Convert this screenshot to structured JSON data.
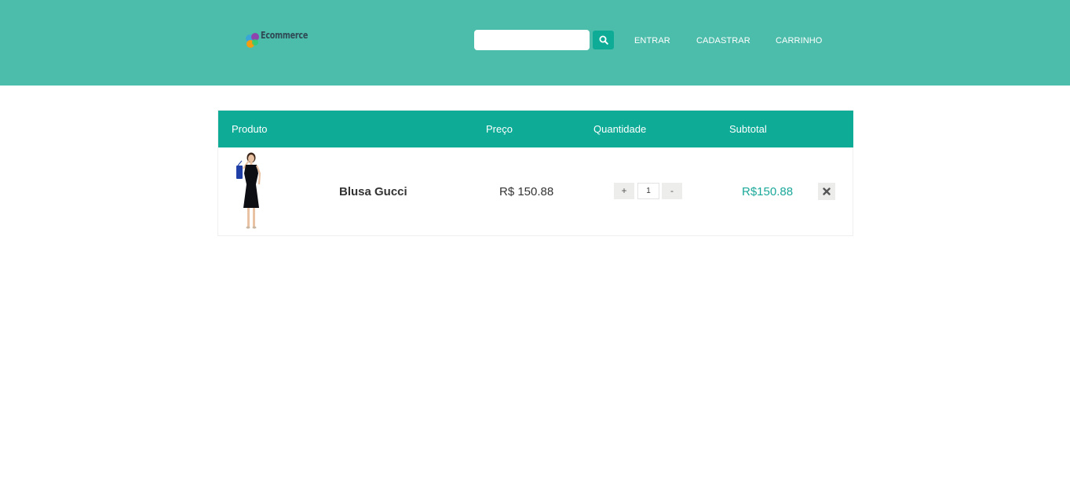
{
  "header": {
    "logo_text": "Ecommerce",
    "search": {
      "value": "",
      "placeholder": ""
    },
    "search_button_icon": "search-icon",
    "nav": {
      "entrar": "ENTRAR",
      "cadastrar": "CADASTRAR",
      "carrinho": "CARRINHO"
    }
  },
  "cart": {
    "columns": {
      "produto": "Produto",
      "preco": "Preço",
      "quantidade": "Quantidade",
      "subtotal": "Subtotal"
    },
    "items": [
      {
        "name": "Blusa Gucci",
        "price": "R$ 150.88",
        "qty_plus": "+",
        "quantity": "1",
        "qty_minus": "-",
        "subtotal": "R$150.88",
        "remove_icon": "close-icon"
      }
    ]
  },
  "colors": {
    "header_bg": "#4cbdab",
    "accent": "#0eab97",
    "subtotal_text": "#1aa899"
  }
}
